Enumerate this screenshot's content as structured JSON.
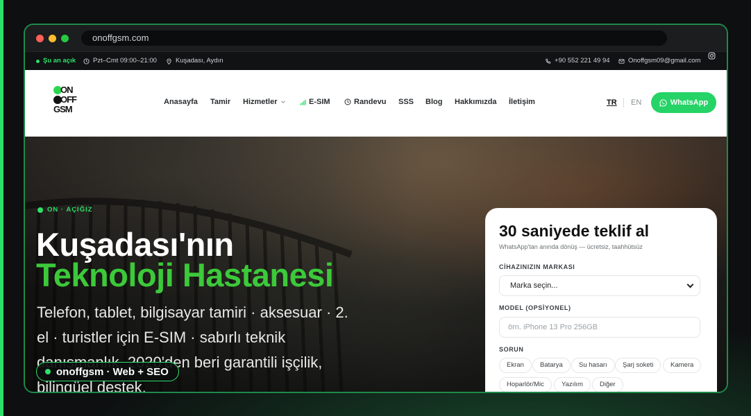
{
  "browser": {
    "url": "onoffgsm.com"
  },
  "topbar": {
    "status": "Şu an açık",
    "hours": "Pzt–Cmt 09:00–21:00",
    "location": "Kuşadası, Aydın",
    "phone": "+90 552 221 49 94",
    "email": "Onoffgsm09@gmail.com"
  },
  "logo": {
    "line1": "ON",
    "line2": "OFF",
    "line3": "GSM"
  },
  "nav": {
    "items": [
      "Anasayfa",
      "Tamir",
      "Hizmetler",
      "E-SIM",
      "Randevu",
      "SSS",
      "Blog",
      "Hakkımızda",
      "İletişim"
    ],
    "lang_tr": "TR",
    "lang_en": "EN",
    "whatsapp": "WhatsApp"
  },
  "hero": {
    "eyebrow": "ON · AÇIĞIZ",
    "title_line1": "Kuşadası'nın",
    "title_line2": "Teknoloji Hastanesi",
    "description": "Telefon, tablet, bilgisayar tamiri · aksesuar · 2. el · turistler için E-SIM · sabırlı teknik danışmanlık. 2020'den beri garantili işçilik, bilingüel destek.",
    "badge": "onoffgsm · Web + SEO"
  },
  "quote_form": {
    "title": "30 saniyede teklif al",
    "subtitle": "WhatsApp'tan anında dönüş — ücretsiz, taahhütsüz",
    "brand_label": "CİHAZINIZIN MARKASI",
    "brand_value": "Marka seçin...",
    "model_label": "MODEL (OPSİYONEL)",
    "model_placeholder": "örn. iPhone 13 Pro 256GB",
    "issue_label": "SORUN",
    "issues": [
      "Ekran",
      "Batarya",
      "Su hasarı",
      "Şarj soketi",
      "Kamera",
      "Hoparlör/Mic",
      "Yazılım",
      "Diğer"
    ]
  },
  "colors": {
    "accent": "#2ee06b",
    "hero_green": "#3cc93a",
    "whatsapp": "#25d366",
    "frame_border": "#1f8a4a"
  },
  "icons": [
    "clock-icon",
    "map-pin-icon",
    "phone-icon",
    "mail-icon",
    "instagram-icon",
    "signal-icon",
    "chevron-down-icon",
    "whatsapp-icon"
  ]
}
